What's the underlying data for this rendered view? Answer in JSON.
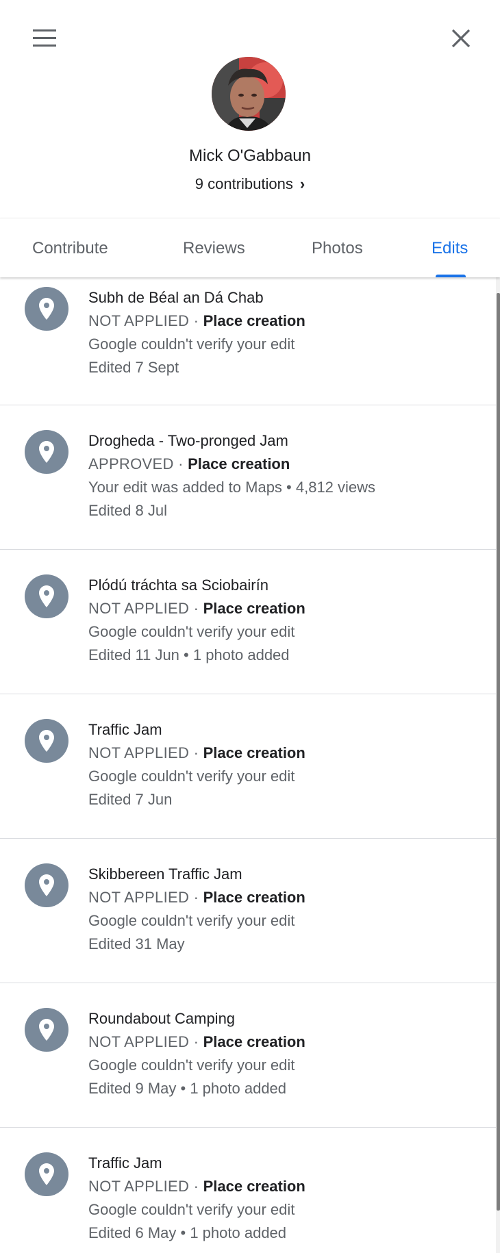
{
  "profile": {
    "name": "Mick O'Gabbaun",
    "contributions": "9 contributions",
    "contributions_chevron": "›"
  },
  "header": {
    "menu_icon": "hamburger-menu-icon",
    "close_icon": "close-icon"
  },
  "tabs": [
    {
      "label": "Contribute",
      "active": false
    },
    {
      "label": "Reviews",
      "active": false
    },
    {
      "label": "Photos",
      "active": false
    },
    {
      "label": "Edits",
      "active": true
    }
  ],
  "colors": {
    "accent": "#1a73e8",
    "pin": "#79899a"
  },
  "edits": [
    {
      "title": "Subh de Béal an Dá Chab",
      "status": "NOT APPLIED",
      "separator": " · ",
      "type": "Place creation",
      "description": "Google couldn't verify your edit",
      "date": "Edited 7 Sept"
    },
    {
      "title": "Drogheda - Two-pronged Jam",
      "status": "APPROVED",
      "separator": " · ",
      "type": "Place creation",
      "description": "Your edit was added to Maps • 4,812 views",
      "date": "Edited 8 Jul"
    },
    {
      "title": "Plódú tráchta sa Sciobairín",
      "status": "NOT APPLIED",
      "separator": " · ",
      "type": "Place creation",
      "description": "Google couldn't verify your edit",
      "date": "Edited 11 Jun • 1 photo added"
    },
    {
      "title": "Traffic Jam",
      "status": "NOT APPLIED",
      "separator": " · ",
      "type": "Place creation",
      "description": "Google couldn't verify your edit",
      "date": "Edited 7 Jun"
    },
    {
      "title": "Skibbereen Traffic Jam",
      "status": "NOT APPLIED",
      "separator": " · ",
      "type": "Place creation",
      "description": "Google couldn't verify your edit",
      "date": "Edited 31 May"
    },
    {
      "title": "Roundabout Camping",
      "status": "NOT APPLIED",
      "separator": " · ",
      "type": "Place creation",
      "description": "Google couldn't verify your edit",
      "date": "Edited 9 May • 1 photo added"
    },
    {
      "title": "Traffic Jam",
      "status": "NOT APPLIED",
      "separator": " · ",
      "type": "Place creation",
      "description": "Google couldn't verify your edit",
      "date": "Edited 6 May • 1 photo added"
    }
  ]
}
